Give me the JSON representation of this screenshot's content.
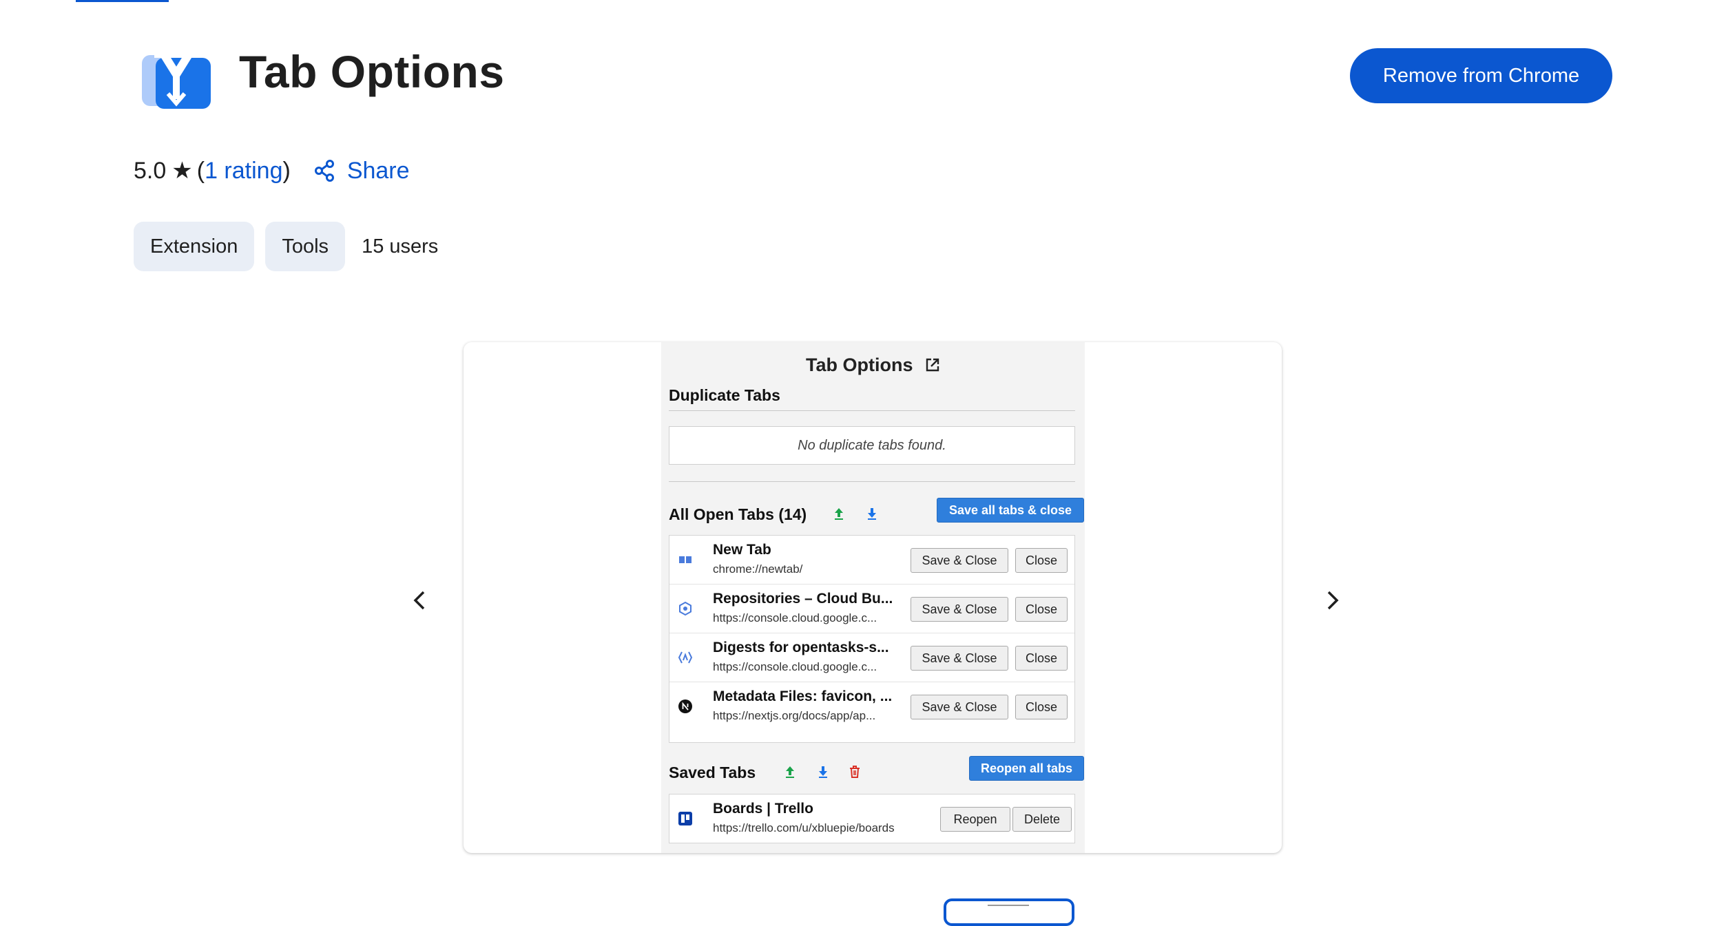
{
  "header": {
    "title": "Tab Options",
    "remove_button_label": "Remove from Chrome",
    "logo_icon": "tab-options-logo-icon"
  },
  "rating": {
    "score": "5.0",
    "open_paren": "(",
    "count_label": "1 rating",
    "close_paren": ")",
    "share_label": "Share"
  },
  "chips": {
    "type_label": "Extension",
    "category_label": "Tools",
    "users_label": "15 users"
  },
  "screenshot": {
    "popup_title": "Tab Options",
    "duplicate_section_title": "Duplicate Tabs",
    "no_duplicates_text": "No duplicate tabs found.",
    "open_tabs_section_title": "All Open Tabs (14)",
    "save_all_button": "Save all tabs & close",
    "open_tabs": [
      {
        "title": "New Tab",
        "url": "chrome://newtab/",
        "save_close": "Save & Close",
        "close": "Close"
      },
      {
        "title": "Repositories – Cloud Bu...",
        "url": "https://console.cloud.google.c...",
        "save_close": "Save & Close",
        "close": "Close"
      },
      {
        "title": "Digests for opentasks-s...",
        "url": "https://console.cloud.google.c...",
        "save_close": "Save & Close",
        "close": "Close"
      },
      {
        "title": "Metadata Files: favicon, ...",
        "url": "https://nextjs.org/docs/app/ap...",
        "save_close": "Save & Close",
        "close": "Close"
      }
    ],
    "saved_section_title": "Saved Tabs",
    "reopen_all_button": "Reopen all tabs",
    "saved_tabs": [
      {
        "title": "Boards | Trello",
        "url": "https://trello.com/u/xbluepie/boards",
        "reopen": "Reopen",
        "delete": "Delete"
      }
    ]
  },
  "colors": {
    "primary": "#0b57d0",
    "chip_bg": "#e9eef6",
    "popup_action_blue": "#2f7fdc",
    "upload_green": "#1aa34a",
    "download_blue": "#1a73e8",
    "trash_red": "#d93025"
  }
}
